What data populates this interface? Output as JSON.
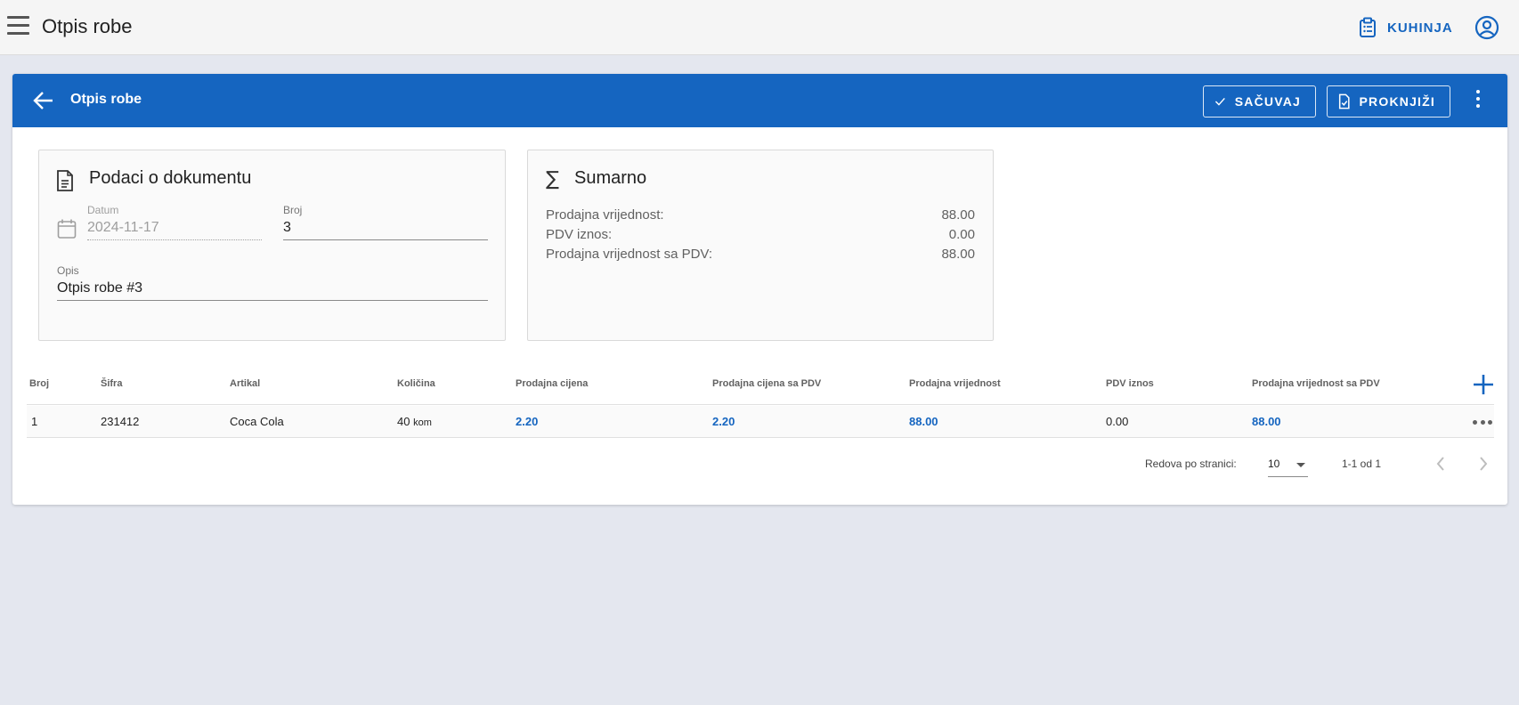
{
  "appbar": {
    "title": "Otpis robe",
    "kitchen_label": "KUHINJA",
    "icons": [
      "menu-icon",
      "clipboard-icon",
      "account-circle-icon"
    ]
  },
  "header": {
    "title": "Otpis robe",
    "save_label": "SAČUVAJ",
    "post_label": "PROKNJIŽI",
    "accent_color": "#1565c0"
  },
  "document": {
    "title": "Podaci o dokumentu",
    "date_label": "Datum",
    "date_value": "2024-11-17",
    "number_label": "Broj",
    "number_value": "3",
    "desc_label": "Opis",
    "desc_value": "Otpis robe #3"
  },
  "summary": {
    "title": "Sumarno",
    "rows": [
      {
        "label": "Prodajna vrijednost:",
        "value": "88.00"
      },
      {
        "label": "PDV iznos:",
        "value": "0.00"
      },
      {
        "label": "Prodajna vrijednost sa PDV:",
        "value": "88.00"
      }
    ]
  },
  "table": {
    "columns": [
      "Broj",
      "Šifra",
      "Artikal",
      "Količina",
      "Prodajna cijena",
      "Prodajna cijena sa PDV",
      "Prodajna vrijednost",
      "PDV iznos",
      "Prodajna vrijednost sa PDV"
    ],
    "rows": [
      {
        "broj": "1",
        "sifra": "231412",
        "artikal": "Coca Cola",
        "kolicina": "40",
        "unit": "kom",
        "prodajna_cijena": "2.20",
        "prodajna_cijena_pdv": "2.20",
        "prodajna_vrijednost": "88.00",
        "pdv_iznos": "0.00",
        "prodajna_vrijednost_pdv": "88.00"
      }
    ]
  },
  "pagination": {
    "rows_per_page_label": "Redova po stranici:",
    "rows_per_page_value": "10",
    "range_label": "1-1 od 1"
  }
}
